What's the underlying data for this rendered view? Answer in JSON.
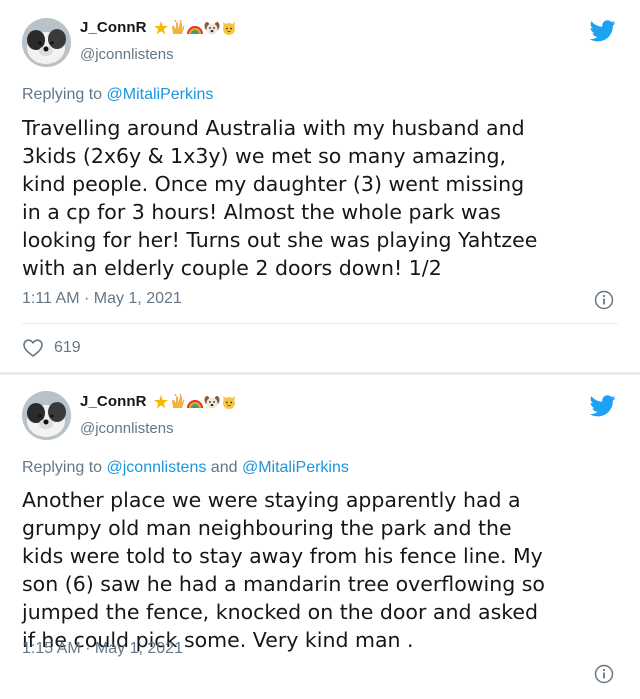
{
  "tweets": [
    {
      "display_name": "J_ConnR",
      "emoji_names": [
        "sparkle-star-icon",
        "raised-hands-icon",
        "rainbow-icon",
        "dog-face-icon",
        "cat-face-icon"
      ],
      "handle": "@jconnlistens",
      "replying_prefix": "Replying to",
      "replying_mentions": [
        "@MitaliPerkins"
      ],
      "body_lines": [
        "Travelling around Australia with my husband and",
        "3kids (2x6y & 1x3y) we met so many amazing,",
        "kind people. Once my daughter (3) went missing",
        "in a cp for 3 hours! Almost the whole park was",
        "looking for her! Turns out she was playing Yahtzee",
        "with an elderly couple 2 doors down! 1/2"
      ],
      "timestamp": "1:11 AM · May 1, 2021",
      "likes": "619"
    },
    {
      "display_name": "J_ConnR",
      "emoji_names": [
        "sparkle-star-icon",
        "raised-hands-icon",
        "rainbow-icon",
        "dog-face-icon",
        "cat-face-icon"
      ],
      "handle": "@jconnlistens",
      "replying_prefix": "Replying to",
      "replying_mentions": [
        "@jconnlistens",
        "@MitaliPerkins"
      ],
      "replying_joiner": "and",
      "body_lines": [
        "Another place we were staying apparently had a",
        "grumpy old man neighbouring the park and the",
        "kids were told to stay away from his fence line. My",
        "son (6) saw he had a mandarin tree overflowing so",
        "jumped the fence, knocked on the door and asked",
        "if he could pick some. Very kind man ."
      ],
      "timestamp": "1:15 AM · May 1, 2021"
    }
  ],
  "colors": {
    "twitter_blue": "#1da1f2",
    "mention_blue": "#1b95e0",
    "secondary_text": "#657786",
    "primary_text": "#14171a",
    "divider": "#e6ecf0"
  }
}
